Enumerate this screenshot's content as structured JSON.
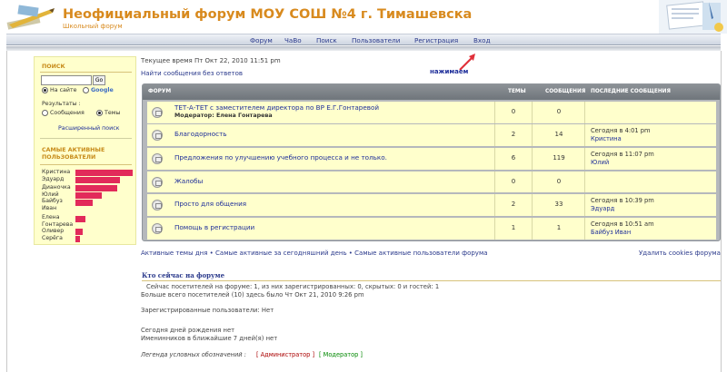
{
  "header": {
    "title": "Неофициальный форум МОУ СОШ №4 г. Тимашевска",
    "subtitle": "Школьный форум"
  },
  "nav": {
    "items": [
      "Форум",
      "ЧаВо",
      "Поиск",
      "Пользователи",
      "Регистрация",
      "Вход"
    ]
  },
  "annotation": {
    "label": "нажимаем",
    "color": "#e0303a"
  },
  "sidebar": {
    "search_title": "Поиск",
    "go_label": "Go",
    "radio_site": "На сайте",
    "radio_google": "Google",
    "results_label": "Результаты :",
    "radio_posts": "Сообщения",
    "radio_topics": "Темы",
    "advanced_search": "Расширенный поиск",
    "active_title": "Самые активные пользователи",
    "users": [
      {
        "name": "Кристина",
        "value": 1.0
      },
      {
        "name": "Эдуард",
        "value": 0.78
      },
      {
        "name": "Дианочка",
        "value": 0.73
      },
      {
        "name": "Юлий",
        "value": 0.46
      },
      {
        "name": "Байбуз Иван",
        "value": 0.3
      },
      {
        "name": "Елена Гонтарева",
        "value": 0.17
      },
      {
        "name": "Оливер",
        "value": 0.12
      },
      {
        "name": "Серёга",
        "value": 0.08
      }
    ],
    "bar_color": "#e22a5a"
  },
  "main": {
    "current_time": "Текущее время Пт Окт 22, 2010 11:51 pm",
    "unanswered_link": "Найти сообщения без ответов",
    "table_headers": {
      "forum": "Форум",
      "topics": "Темы",
      "posts": "Сообщения",
      "last": "Последние сообщения"
    },
    "forums": [
      {
        "title": "ТЕТ-А-ТЕТ с заместителем директора по ВР Е.Г.Гонтаревой",
        "moderator_label": "Модератор:",
        "moderator": "Елена Гонтарева",
        "topics": "0",
        "posts": "0",
        "last_time": "",
        "last_user": ""
      },
      {
        "title": "Благодорность",
        "moderator_label": "",
        "moderator": "",
        "topics": "2",
        "posts": "14",
        "last_time": "Сегодня в 4:01 pm",
        "last_user": "Кристина"
      },
      {
        "title": "Предложения по улучшению учебного процесса и не только.",
        "moderator_label": "",
        "moderator": "",
        "topics": "6",
        "posts": "119",
        "last_time": "Сегодня в 11:07 pm",
        "last_user": "Юлий"
      },
      {
        "title": "Жалобы",
        "moderator_label": "",
        "moderator": "",
        "topics": "0",
        "posts": "0",
        "last_time": "",
        "last_user": ""
      },
      {
        "title": "Просто для общения",
        "moderator_label": "",
        "moderator": "",
        "topics": "2",
        "posts": "33",
        "last_time": "Сегодня в 10:39 pm",
        "last_user": "Эдуард"
      },
      {
        "title": "Помощь в регистрации",
        "moderator_label": "",
        "moderator": "",
        "topics": "1",
        "posts": "1",
        "last_time": "Сегодня в 10:51 am",
        "last_user": "Байбуз Иван"
      }
    ],
    "links_line": "Активные темы дня • Самые активные за сегодняшний день • Самые активные пользователи форума",
    "delete_cookies": "Удалить cookies форума",
    "who_title": "Кто сейчас на форуме",
    "online_line": "Сейчас посетителей на форуме: 1, из них зарегистрированных: 0, скрытых: 0 и гостей: 1",
    "record_line": "Больше всего посетителей (10) здесь было Чт Окт 21, 2010 9:26 pm",
    "registered_line": "Зарегистрированные пользователи: Нет",
    "birthday_line": "Сегодня дней рождения нет",
    "birthday_week": "Именинников в ближайшие 7 дней(я) нет",
    "legend_label": "Легенда условных обозначений :",
    "legend_admin": "[ Администратор ]",
    "legend_mod": "[ Модератор ]",
    "admin_color": "#aa0000",
    "mod_color": "#008800"
  }
}
